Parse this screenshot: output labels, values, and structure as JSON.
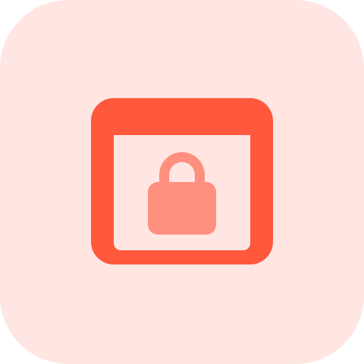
{
  "icon": {
    "name": "browser-lock-icon",
    "colors": {
      "background": "#FFE6E2",
      "window": "#FF583D",
      "lock": "#FF8F7E"
    }
  }
}
